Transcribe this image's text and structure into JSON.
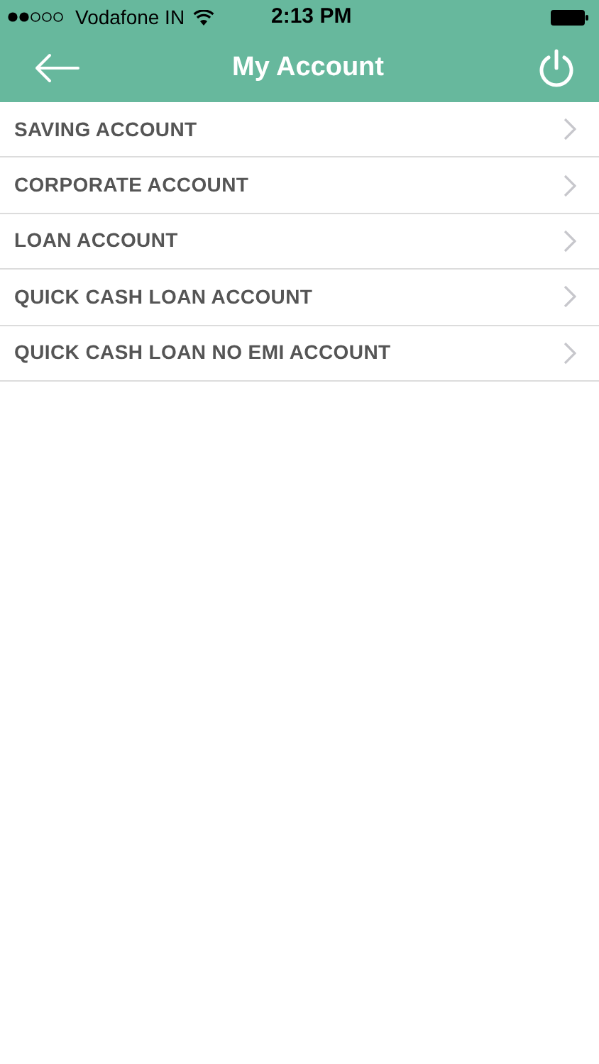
{
  "status_bar": {
    "carrier": "Vodafone IN",
    "time": "2:13 PM"
  },
  "nav_bar": {
    "title": "My Account"
  },
  "accounts": [
    {
      "label": "SAVING ACCOUNT"
    },
    {
      "label": "CORPORATE ACCOUNT"
    },
    {
      "label": "LOAN ACCOUNT"
    },
    {
      "label": "QUICK CASH LOAN ACCOUNT"
    },
    {
      "label": "QUICK CASH LOAN NO EMI ACCOUNT"
    }
  ]
}
